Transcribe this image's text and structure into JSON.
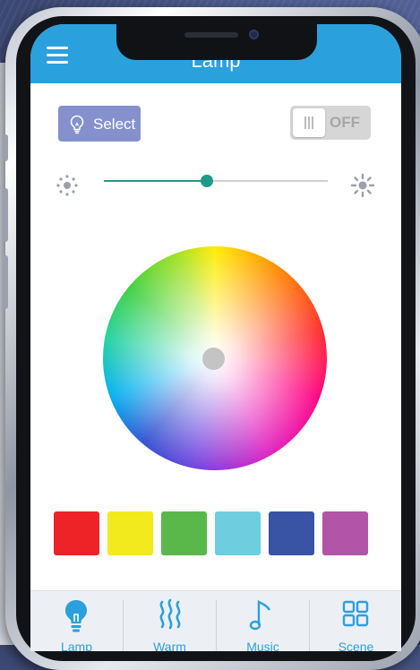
{
  "app": {
    "title": "Lamp"
  },
  "header": {
    "menu_icon": "hamburger-menu-icon"
  },
  "controls": {
    "select_label": "Select",
    "select_icon": "lightbulb-icon",
    "power_toggle_label": "OFF",
    "power_on": false
  },
  "brightness": {
    "value": 0.5,
    "low_icon": "dim-sun-icon",
    "high_icon": "bright-sun-icon"
  },
  "color_picker": {
    "type": "color-wheel"
  },
  "swatches": [
    {
      "name": "red",
      "color": "#ee2327"
    },
    {
      "name": "yellow",
      "color": "#f2ea1c"
    },
    {
      "name": "green",
      "color": "#5ab84a"
    },
    {
      "name": "cyan",
      "color": "#6ecdde"
    },
    {
      "name": "blue",
      "color": "#3a54a5"
    },
    {
      "name": "purple",
      "color": "#b254a8"
    }
  ],
  "tabs": [
    {
      "label": "Lamp",
      "icon": "lightbulb-icon"
    },
    {
      "label": "Warm",
      "icon": "warm-waves-icon"
    },
    {
      "label": "Music",
      "icon": "music-note-icon"
    },
    {
      "label": "Scene",
      "icon": "grid-icon"
    }
  ],
  "colors": {
    "accent": "#2aa0dc",
    "slider": "#1f9a86",
    "select_button": "#8591cd"
  }
}
